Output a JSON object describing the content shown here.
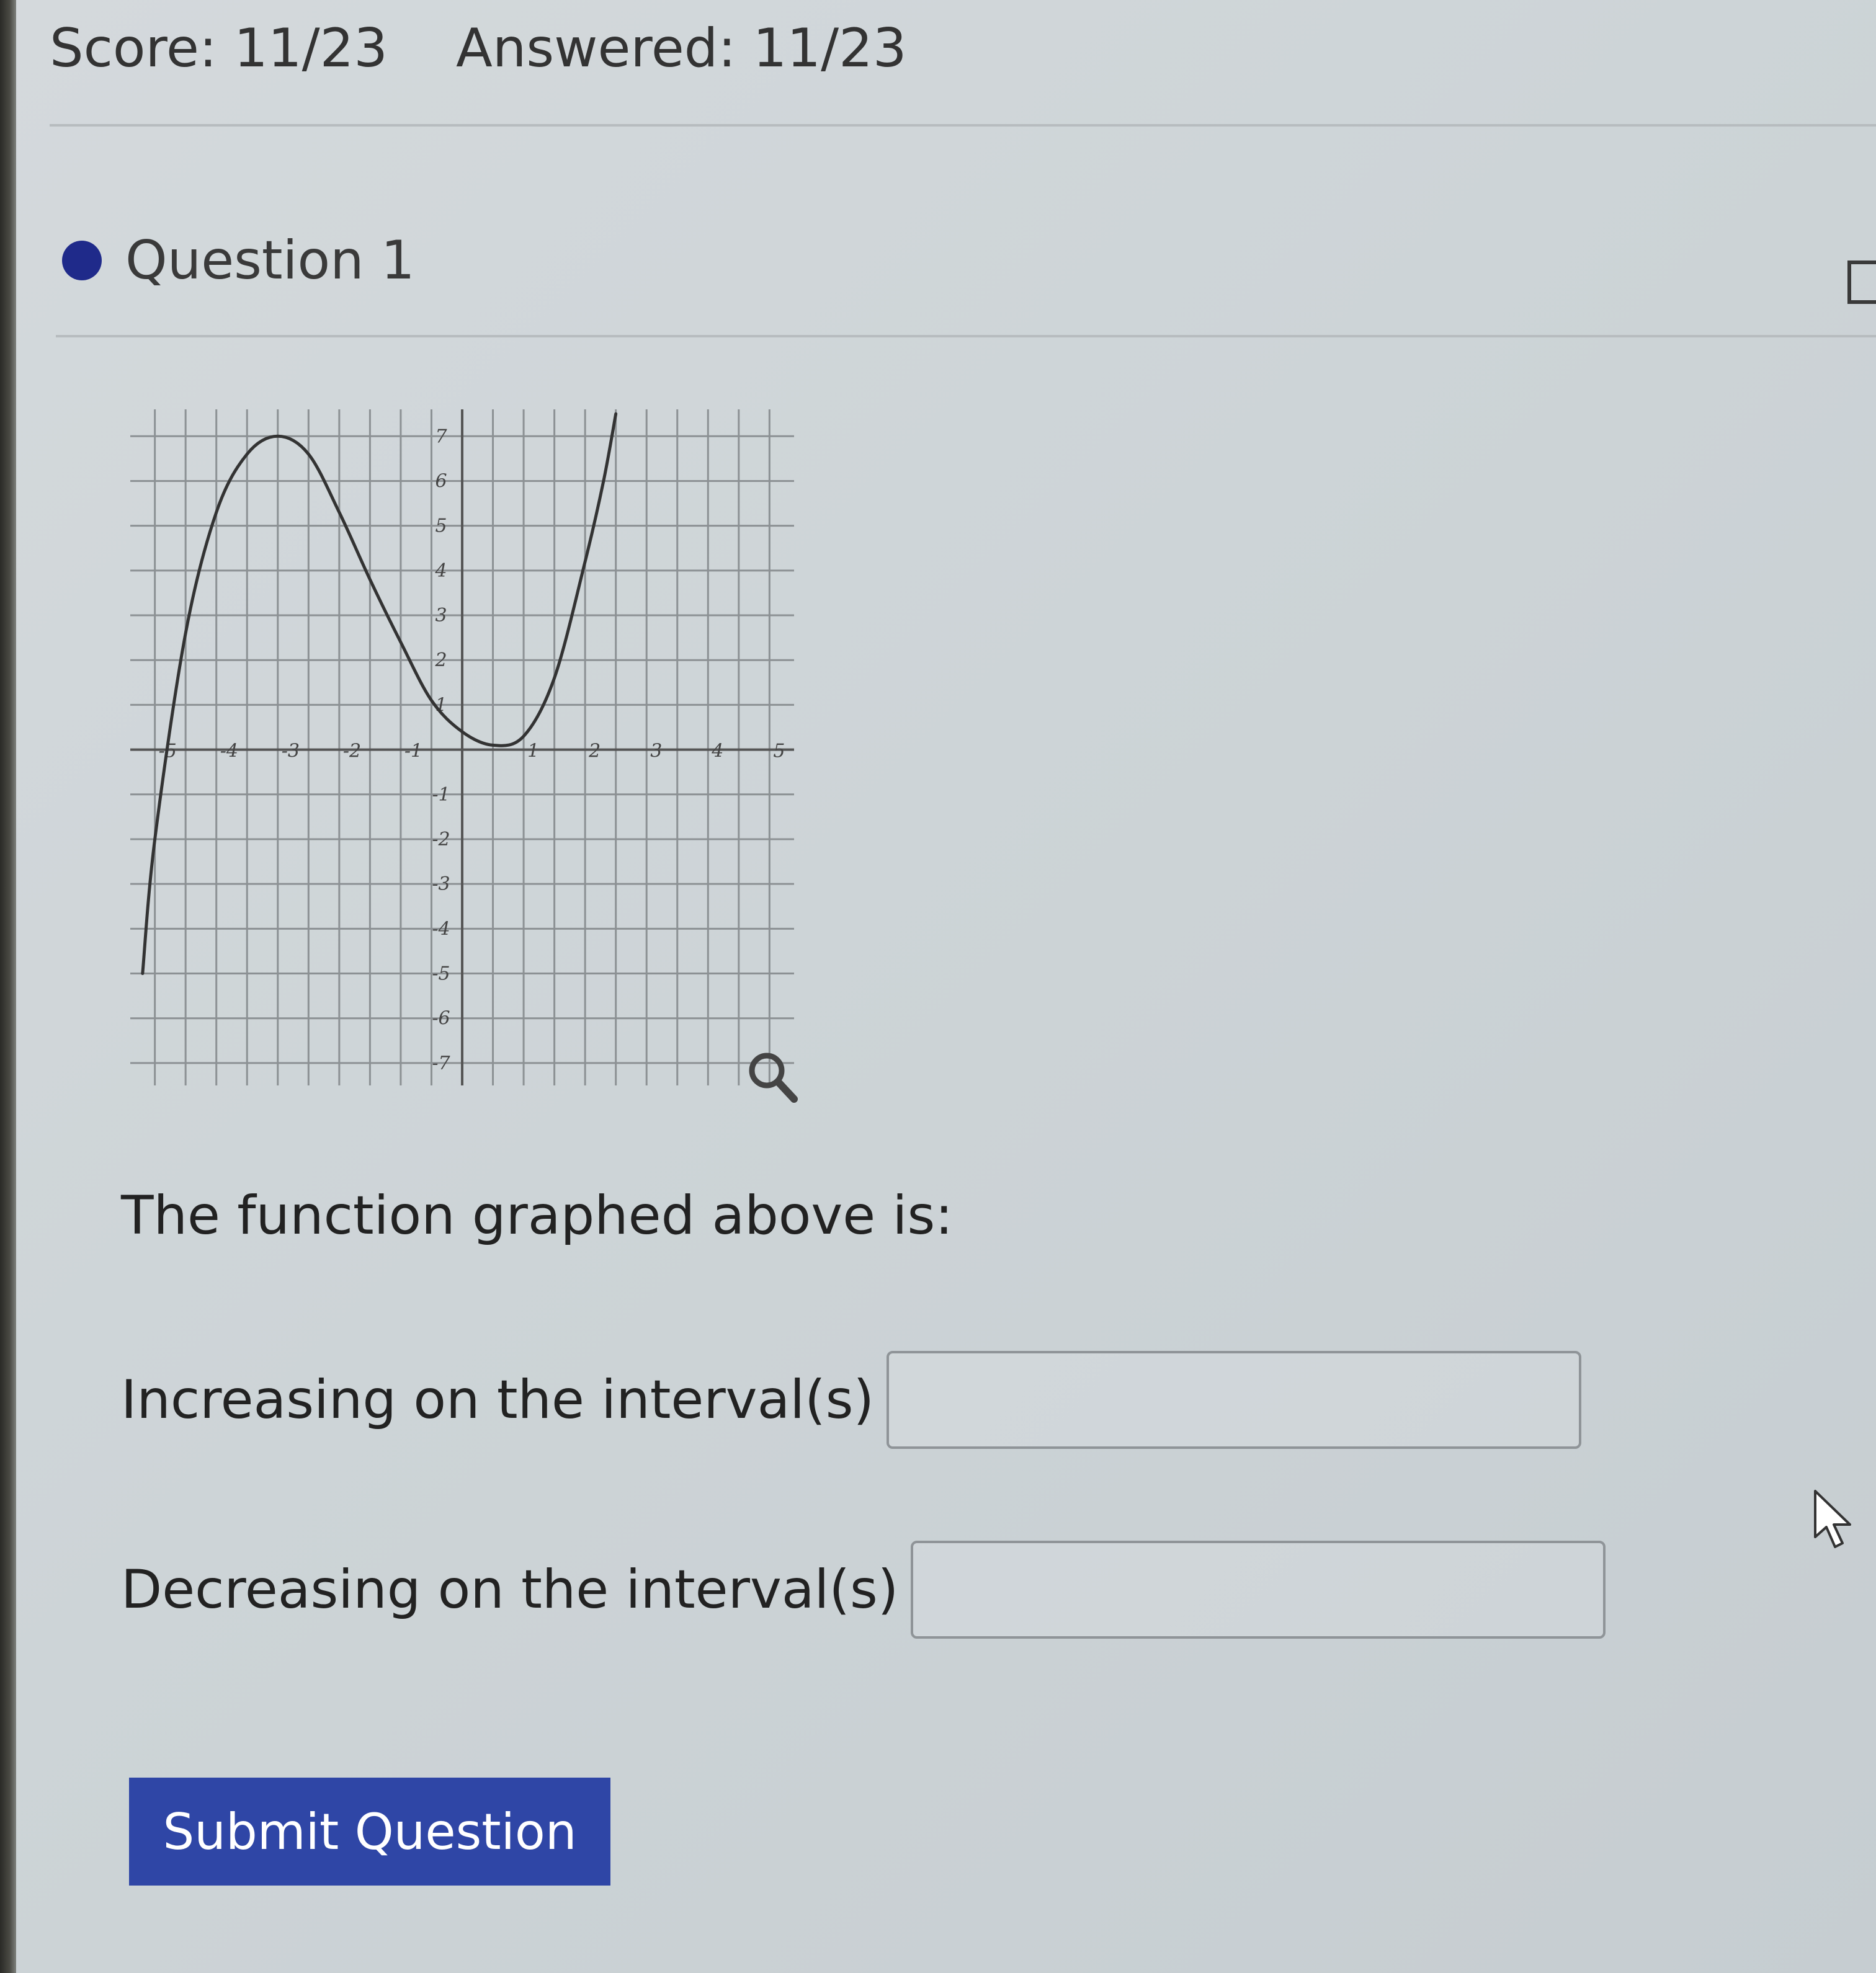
{
  "score_bar": {
    "score": "Score: 11/23",
    "answered": "Answered: 11/23"
  },
  "question": {
    "title": "Question 1",
    "status_color": "#1f2a8a"
  },
  "chart_data": {
    "type": "line",
    "title": "",
    "xlabel": "",
    "ylabel": "",
    "xlim": [
      -5,
      5
    ],
    "ylim": [
      -7,
      7
    ],
    "grid": true,
    "x_ticks": [
      "-5",
      "-4",
      "-3",
      "-2",
      "-1",
      "1",
      "2",
      "3",
      "4",
      "5"
    ],
    "y_ticks": [
      "7",
      "6",
      "5",
      "4",
      "3",
      "2",
      "1",
      "-1",
      "-2",
      "-3",
      "-4",
      "-5",
      "-6",
      "-7"
    ],
    "series": [
      {
        "x": [
          -5.2,
          -5,
          -4.5,
          -4,
          -3.5,
          -3,
          -2.5,
          -2,
          -1.5,
          -1,
          -0.5,
          0,
          0.5,
          1,
          1.5,
          2,
          2.3,
          2.5
        ],
        "y": [
          -5.0,
          -2.0,
          2.6,
          5.3,
          6.6,
          7.0,
          6.6,
          5.3,
          3.8,
          2.4,
          1.1,
          0.4,
          0.1,
          0.3,
          1.6,
          4.2,
          6.0,
          7.5
        ]
      }
    ]
  },
  "prompt": "The function graphed above is:",
  "increasing": {
    "label": "Increasing on the interval(s)",
    "value": ""
  },
  "decreasing": {
    "label": "Decreasing on the interval(s)",
    "value": ""
  },
  "submit_label": "Submit Question",
  "icons": {
    "magnifier": "magnifier-icon",
    "header": "collapse-icon",
    "cursor": "mouse-pointer-icon"
  }
}
